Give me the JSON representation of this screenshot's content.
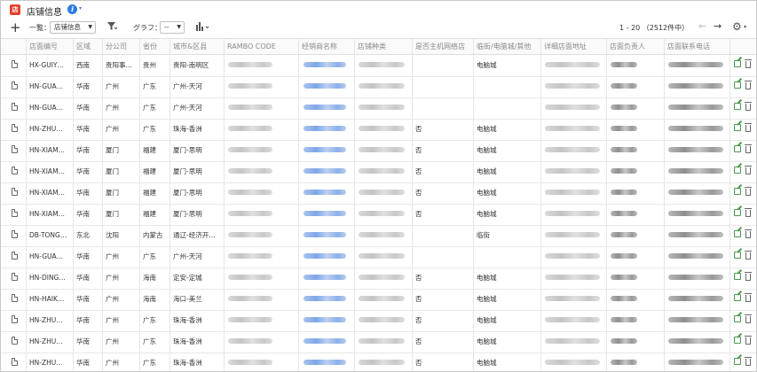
{
  "app": {
    "title": "店铺信息",
    "icon_text": "店",
    "info_icon": "i"
  },
  "toolbar": {
    "add_icon": "+",
    "list_label": "一覧：",
    "list_value": "店铺信息",
    "filter_icon": "filter-icon",
    "graph_label": "グラフ：",
    "graph_value": "--",
    "chart_icon": "bar-chart-icon",
    "pager_text": "1 - 20 （2512件中）",
    "prev_icon": "←",
    "next_icon": "→",
    "gear_icon": "⚙"
  },
  "columns": [
    "店面编号",
    "区域",
    "分公司",
    "省份",
    "城市&区县",
    "RAMBO CODE",
    "经销商名称",
    "店铺种类",
    "是否主机网络店",
    "临街/电脑城/其他",
    "详细店面地址",
    "店面负责人",
    "店面联系电话"
  ],
  "rows": [
    {
      "code": "HX-GUIY…",
      "region": "西南",
      "branch": "贵阳事…",
      "province": "贵州",
      "city": "贵阳-南明区",
      "net": "",
      "street": "电脑城"
    },
    {
      "code": "HN-GUA…",
      "region": "华南",
      "branch": "广州",
      "province": "广东",
      "city": "广州-天河",
      "net": "",
      "street": ""
    },
    {
      "code": "HN-GUA…",
      "region": "华南",
      "branch": "广州",
      "province": "广东",
      "city": "广州-天河",
      "net": "",
      "street": ""
    },
    {
      "code": "HN-ZHU…",
      "region": "华南",
      "branch": "广州",
      "province": "广东",
      "city": "珠海-香洲",
      "net": "否",
      "street": "电脑城"
    },
    {
      "code": "HN-XIAM…",
      "region": "华南",
      "branch": "厦门",
      "province": "福建",
      "city": "厦门-思明",
      "net": "否",
      "street": "电脑城"
    },
    {
      "code": "HN-XIAM…",
      "region": "华南",
      "branch": "厦门",
      "province": "福建",
      "city": "厦门-思明",
      "net": "否",
      "street": "电脑城"
    },
    {
      "code": "HN-XIAM…",
      "region": "华南",
      "branch": "厦门",
      "province": "福建",
      "city": "厦门-思明",
      "net": "否",
      "street": "电脑城"
    },
    {
      "code": "HN-XIAM…",
      "region": "华南",
      "branch": "厦门",
      "province": "福建",
      "city": "厦门-思明",
      "net": "否",
      "street": "电脑城"
    },
    {
      "code": "DB-TONG…",
      "region": "东北",
      "branch": "沈阳",
      "province": "内蒙古",
      "city": "通辽-经济开…",
      "net": "",
      "street": "临街"
    },
    {
      "code": "HN-GUA…",
      "region": "华南",
      "branch": "广州",
      "province": "广东",
      "city": "广州-天河",
      "net": "",
      "street": ""
    },
    {
      "code": "HN-DING…",
      "region": "华南",
      "branch": "广州",
      "province": "海南",
      "city": "定安-定城",
      "net": "否",
      "street": "电脑城"
    },
    {
      "code": "HN-HAIK…",
      "region": "华南",
      "branch": "广州",
      "province": "海南",
      "city": "海口-美兰",
      "net": "否",
      "street": "电脑城"
    },
    {
      "code": "HN-ZHU…",
      "region": "华南",
      "branch": "广州",
      "province": "广东",
      "city": "珠海-香洲",
      "net": "否",
      "street": "电脑城"
    },
    {
      "code": "HN-ZHU…",
      "region": "华南",
      "branch": "广州",
      "province": "广东",
      "city": "珠海-香洲",
      "net": "否",
      "street": "电脑城"
    },
    {
      "code": "HN-ZHU…",
      "region": "华南",
      "branch": "广州",
      "province": "广东",
      "city": "珠海-香洲",
      "net": "否",
      "street": "电脑城"
    }
  ]
}
